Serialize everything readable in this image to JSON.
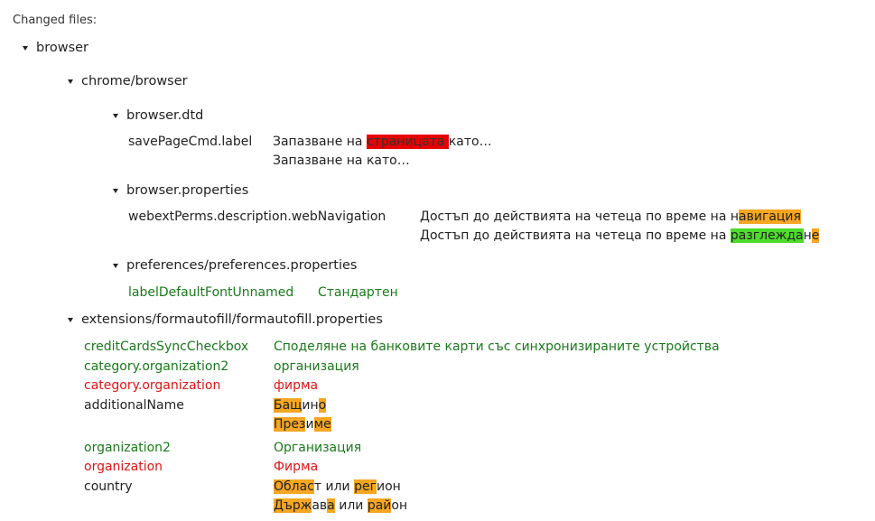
{
  "heading": "Changed files:",
  "tree": {
    "browser": "browser",
    "chrome_browser": "chrome/browser",
    "browser_dtd": "browser.dtd",
    "browser_properties": "browser.properties",
    "preferences": "preferences/preferences.properties",
    "formautofill": "extensions/formautofill/formautofill.properties"
  },
  "entries": [
    {
      "key": "savePageCmd.label",
      "status": "changed",
      "old": [
        [
          "Запазване на ",
          ""
        ],
        [
          "страницата ",
          "red"
        ],
        [
          "като…",
          ""
        ]
      ],
      "new": [
        [
          "Запазване на като…",
          ""
        ]
      ]
    },
    {
      "key": "webextPerms.description.webNavigation",
      "status": "changed",
      "old": [
        [
          "Достъп до действията на четеца по време на н",
          ""
        ],
        [
          "авигация",
          "orange"
        ]
      ],
      "new": [
        [
          "Достъп до действията на четеца по време на ",
          ""
        ],
        [
          "разглежда",
          "green"
        ],
        [
          "н",
          ""
        ],
        [
          "е",
          "orange"
        ]
      ]
    },
    {
      "key": "labelDefaultFontUnnamed",
      "status": "added",
      "value": "Стандартен"
    },
    {
      "key": "creditCardsSyncCheckbox",
      "status": "added",
      "value": "Споделяне на банковите карти със синхронизираните устройства"
    },
    {
      "key": "category.organization2",
      "status": "added",
      "value": "организация"
    },
    {
      "key": "category.organization",
      "status": "removed",
      "value": "фирма"
    },
    {
      "key": "additionalName",
      "status": "changed",
      "old": [
        [
          "Бащ",
          "orange"
        ],
        [
          "ин",
          ""
        ],
        [
          "о",
          "orange"
        ]
      ],
      "new": [
        [
          "През",
          "orange"
        ],
        [
          "и",
          ""
        ],
        [
          "ме",
          "orange"
        ]
      ]
    },
    {
      "key": "organization2",
      "status": "added",
      "value": "Организация"
    },
    {
      "key": "organization",
      "status": "removed",
      "value": "Фирма"
    },
    {
      "key": "country",
      "status": "changed",
      "old": [
        [
          "Облас",
          "orange"
        ],
        [
          "т",
          ""
        ],
        [
          " или ",
          ""
        ],
        [
          "рег",
          "orange"
        ],
        [
          "и",
          ""
        ],
        [
          "он",
          ""
        ]
      ],
      "new": [
        [
          "Държ",
          "orange"
        ],
        [
          "ав",
          ""
        ],
        [
          "а",
          "orange"
        ],
        [
          " или ",
          ""
        ],
        [
          "ра",
          "orange"
        ],
        [
          "й",
          "orange"
        ],
        [
          "он",
          ""
        ]
      ]
    }
  ]
}
